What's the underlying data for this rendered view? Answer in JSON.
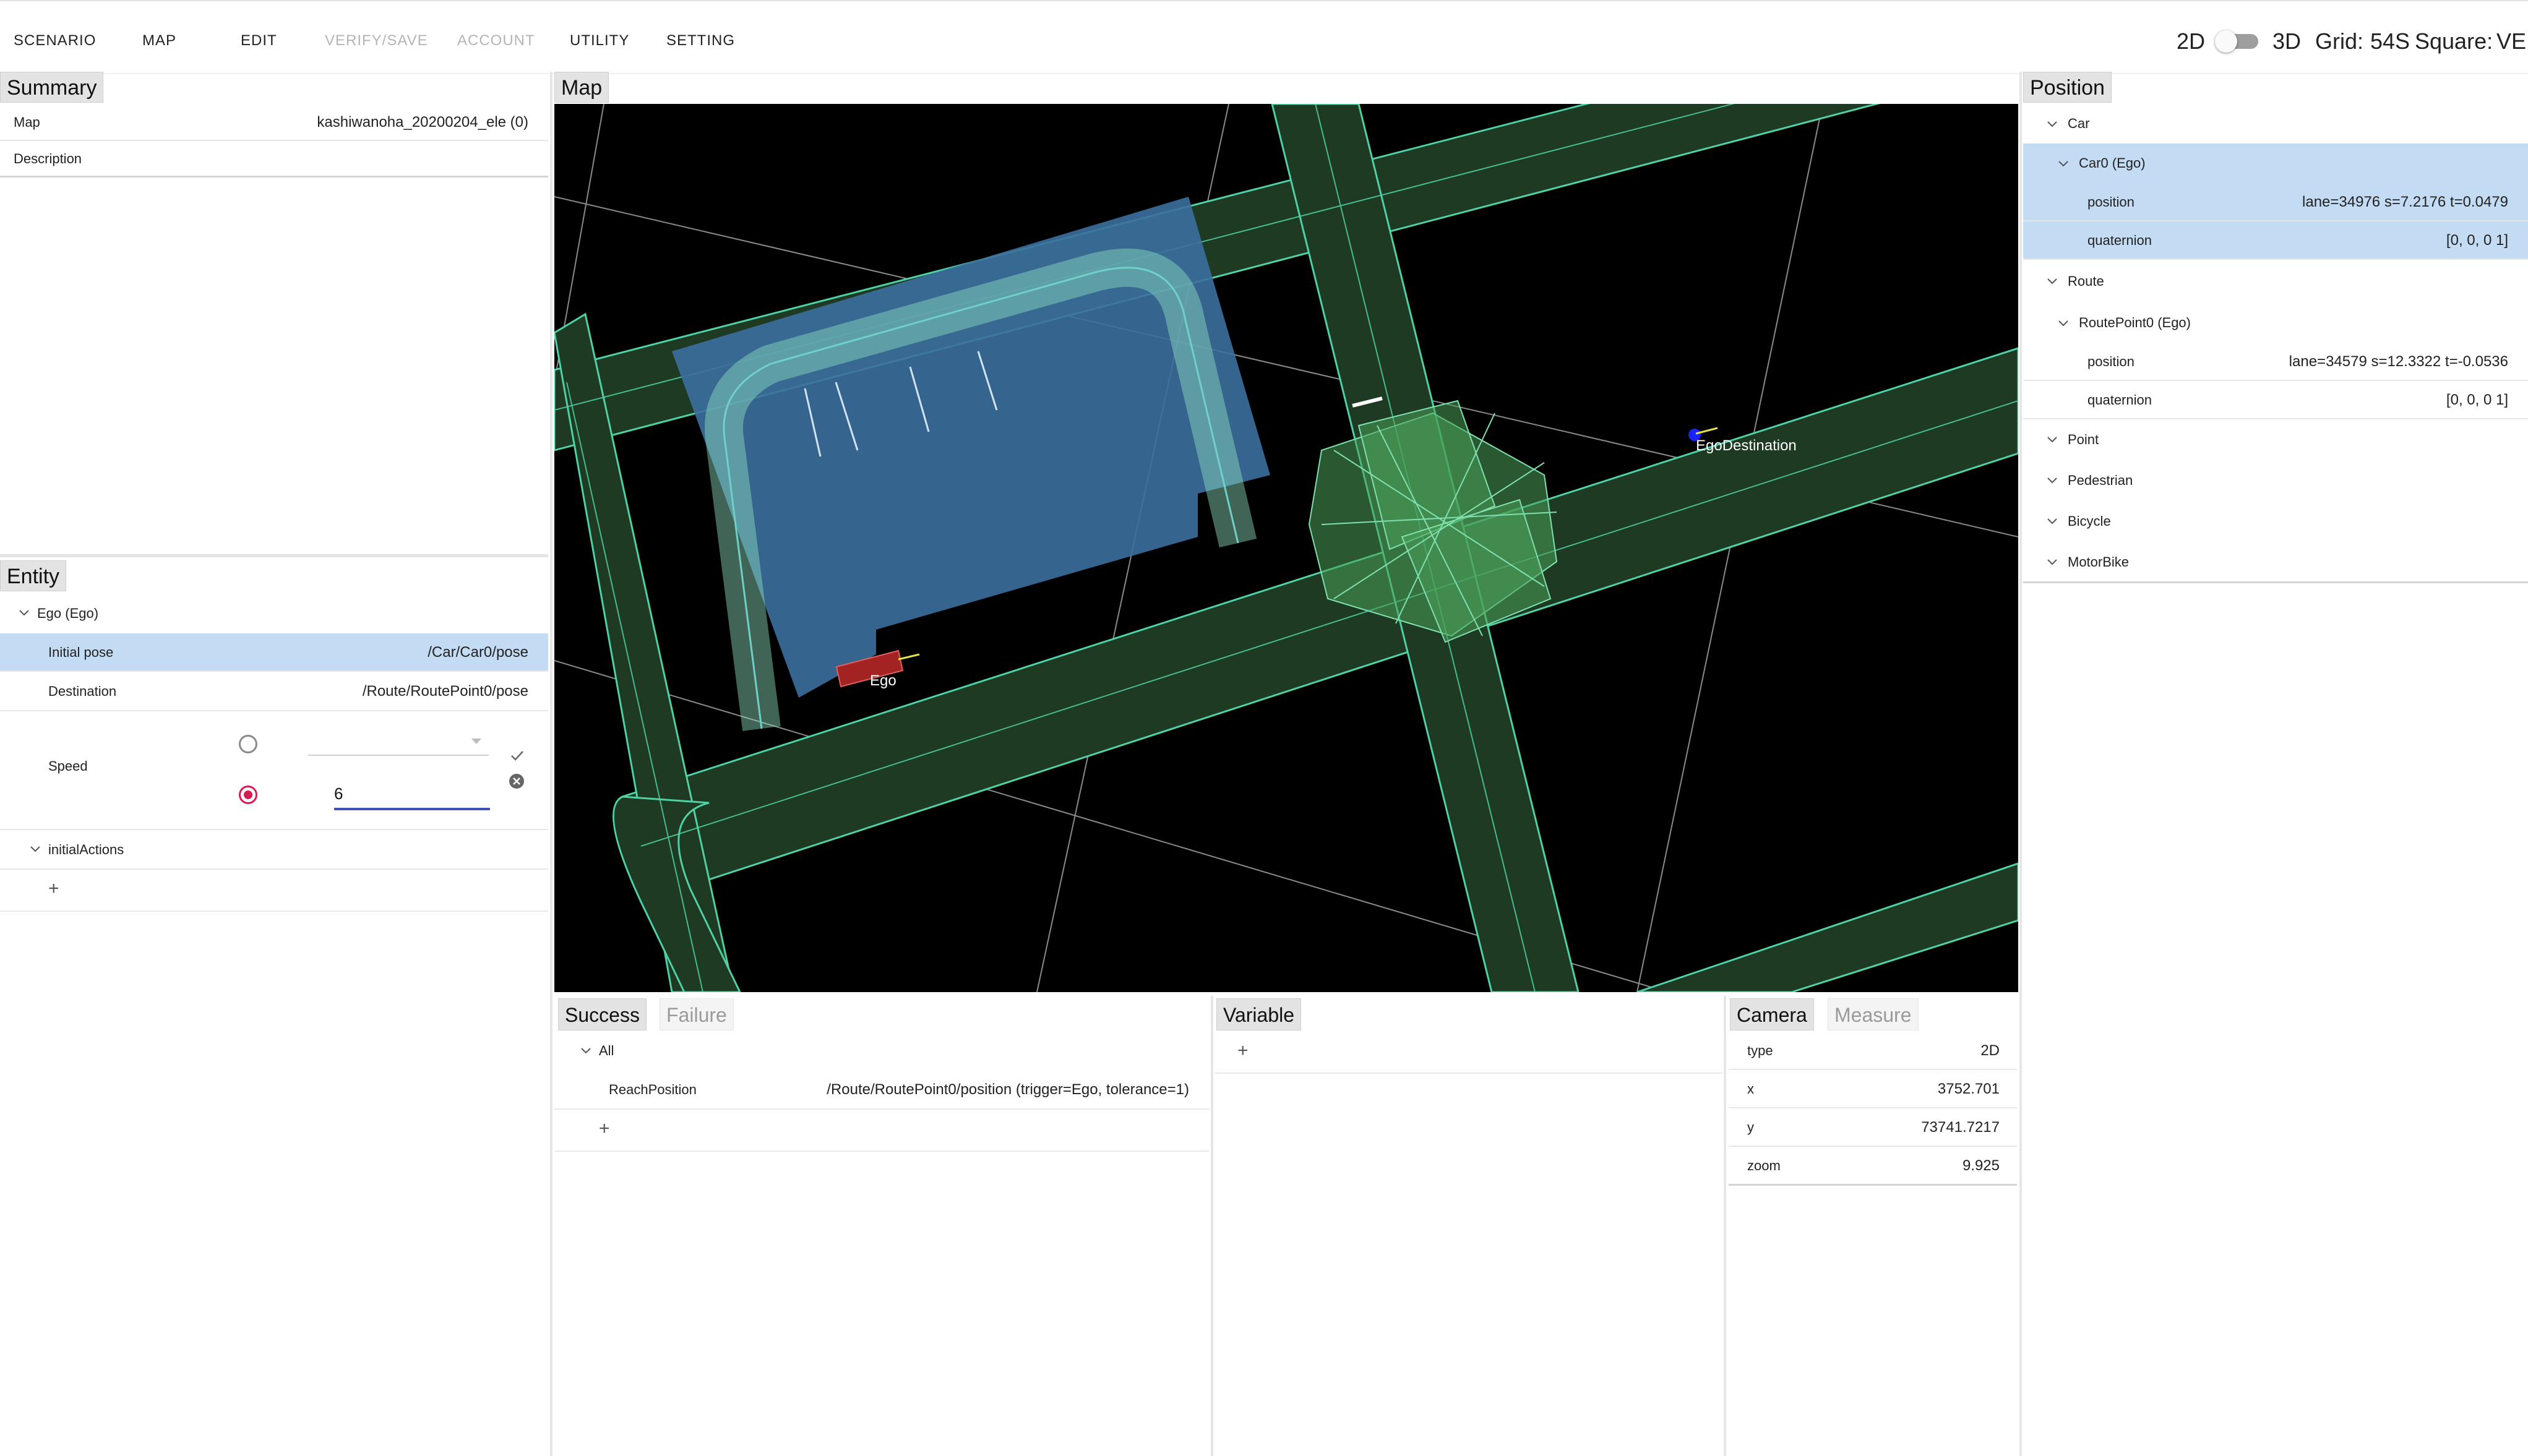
{
  "menu": {
    "scenario": "SCENARIO",
    "map": "MAP",
    "edit": "EDIT",
    "verify_save": "VERIFY/SAVE",
    "account": "ACCOUNT",
    "utility": "UTILITY",
    "setting": "SETTING"
  },
  "view_toggle": {
    "label_2d": "2D",
    "label_3d": "3D",
    "is_3d": false
  },
  "grid": {
    "label": "Grid:",
    "value": "54S"
  },
  "square": {
    "label": "Square:",
    "value": "VE"
  },
  "summary": {
    "tab": "Summary",
    "rows": [
      {
        "key": "Map",
        "value": "kashiwanoha_20200204_ele (0)"
      },
      {
        "key": "Description",
        "value": ""
      }
    ]
  },
  "entity": {
    "tab": "Entity",
    "ego_node": "Ego (Ego)",
    "initial_pose": {
      "key": "Initial pose",
      "value": "/Car/Car0/pose"
    },
    "destination": {
      "key": "Destination",
      "value": "/Route/RoutePoint0/pose"
    },
    "speed": {
      "key": "Speed",
      "select_value": "",
      "input_value": "6",
      "selected_option": 2
    },
    "initial_actions": "initialActions",
    "add": "+"
  },
  "map_panel": {
    "tab": "Map",
    "labels": {
      "ego": "Ego",
      "ego_destination": "EgoDestination"
    },
    "colors": {
      "background": "#000000",
      "road": "#1e3a22",
      "lane_line": "#4fd1a5",
      "parking": "#3b6f9e",
      "ego": "#a32222",
      "destination_dot": "#1a22ff"
    }
  },
  "position": {
    "tab": "Position",
    "car": "Car",
    "car0": "Car0 (Ego)",
    "car0_position": {
      "key": "position",
      "value": "lane=34976 s=7.2176 t=0.0479"
    },
    "car0_quaternion": {
      "key": "quaternion",
      "value": "[0, 0, 0 1]"
    },
    "route": "Route",
    "routepoint0": "RoutePoint0 (Ego)",
    "rp_position": {
      "key": "position",
      "value": "lane=34579 s=12.3322 t=-0.0536"
    },
    "rp_quaternion": {
      "key": "quaternion",
      "value": "[0, 0, 0 1]"
    },
    "point": "Point",
    "pedestrian": "Pedestrian",
    "bicycle": "Bicycle",
    "motorbike": "MotorBike"
  },
  "conditions": {
    "tab_success": "Success",
    "tab_failure": "Failure",
    "all": "All",
    "row": {
      "key": "ReachPosition",
      "value": "/Route/RoutePoint0/position (trigger=Ego, tolerance=1)"
    },
    "add": "+"
  },
  "variable": {
    "tab": "Variable",
    "add": "+"
  },
  "camera": {
    "tab_camera": "Camera",
    "tab_measure": "Measure",
    "rows": [
      {
        "key": "type",
        "value": "2D"
      },
      {
        "key": "x",
        "value": "3752.701"
      },
      {
        "key": "y",
        "value": "73741.7217"
      },
      {
        "key": "zoom",
        "value": "9.925"
      }
    ]
  }
}
